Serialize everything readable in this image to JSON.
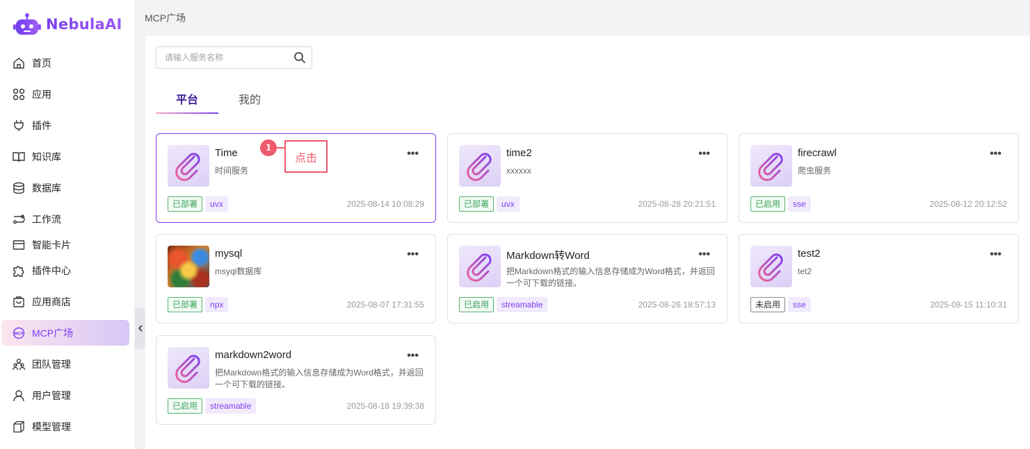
{
  "app": {
    "name": "NebulaAI"
  },
  "sidebar": {
    "items": [
      {
        "label": "首页",
        "icon": "home-icon"
      },
      {
        "label": "应用",
        "icon": "apps-icon"
      },
      {
        "label": "插件",
        "icon": "plug-icon"
      },
      {
        "label": "知识库",
        "icon": "book-icon"
      },
      {
        "label": "数据库",
        "icon": "database-icon"
      },
      {
        "label": "工作流",
        "icon": "workflow-icon"
      },
      {
        "label": "智能卡片",
        "icon": "card-icon"
      },
      {
        "label": "插件中心",
        "icon": "puzzle-icon"
      },
      {
        "label": "应用商店",
        "icon": "store-icon"
      },
      {
        "label": "MCP广场",
        "icon": "mcp-icon",
        "active": true
      },
      {
        "label": "团队管理",
        "icon": "team-icon"
      },
      {
        "label": "用户管理",
        "icon": "user-icon"
      },
      {
        "label": "模型管理",
        "icon": "cube-icon"
      }
    ]
  },
  "header": {
    "breadcrumb": "MCP广场"
  },
  "search": {
    "placeholder": "请输入服务名称"
  },
  "tabs": [
    {
      "label": "平台",
      "active": true
    },
    {
      "label": "我的"
    }
  ],
  "cards": [
    {
      "title": "Time",
      "desc": "时间服务",
      "status": "已部署",
      "type": "uvx",
      "date": "2025-08-14 10:08:29",
      "selected": true
    },
    {
      "title": "time2",
      "desc": "xxxxxx",
      "status": "已部署",
      "type": "uvx",
      "date": "2025-08-28 20:21:51"
    },
    {
      "title": "firecrawl",
      "desc": "爬虫服务",
      "status": "已启用",
      "type": "sse",
      "date": "2025-08-12 20:12:52"
    },
    {
      "title": "mysql",
      "desc": "msyql数据库",
      "status": "已部署",
      "type": "npx",
      "date": "2025-08-07 17:31:55",
      "image": "painting"
    },
    {
      "title": "Markdown转Word",
      "desc": "把Markdown格式的输入信息存储成为Word格式，并返回一个可下载的链接。",
      "status": "已启用",
      "type": "streamable",
      "date": "2025-08-26 18:57:13"
    },
    {
      "title": "test2",
      "desc": "tet2",
      "status": "未启用",
      "type": "sse",
      "date": "2025-08-15 11:10:31"
    },
    {
      "title": "markdown2word",
      "desc": "把Markdown格式的输入信息存储成为Word格式，并返回一个可下载的链接。",
      "status": "已启用",
      "type": "streamable",
      "date": "2025-08-18 19:39:38"
    }
  ],
  "annotation": {
    "number": "1",
    "label": "点击"
  },
  "colors": {
    "accent": "#7b3ff2",
    "annotation": "#f05a6e",
    "status_green": "#3aa35a"
  }
}
